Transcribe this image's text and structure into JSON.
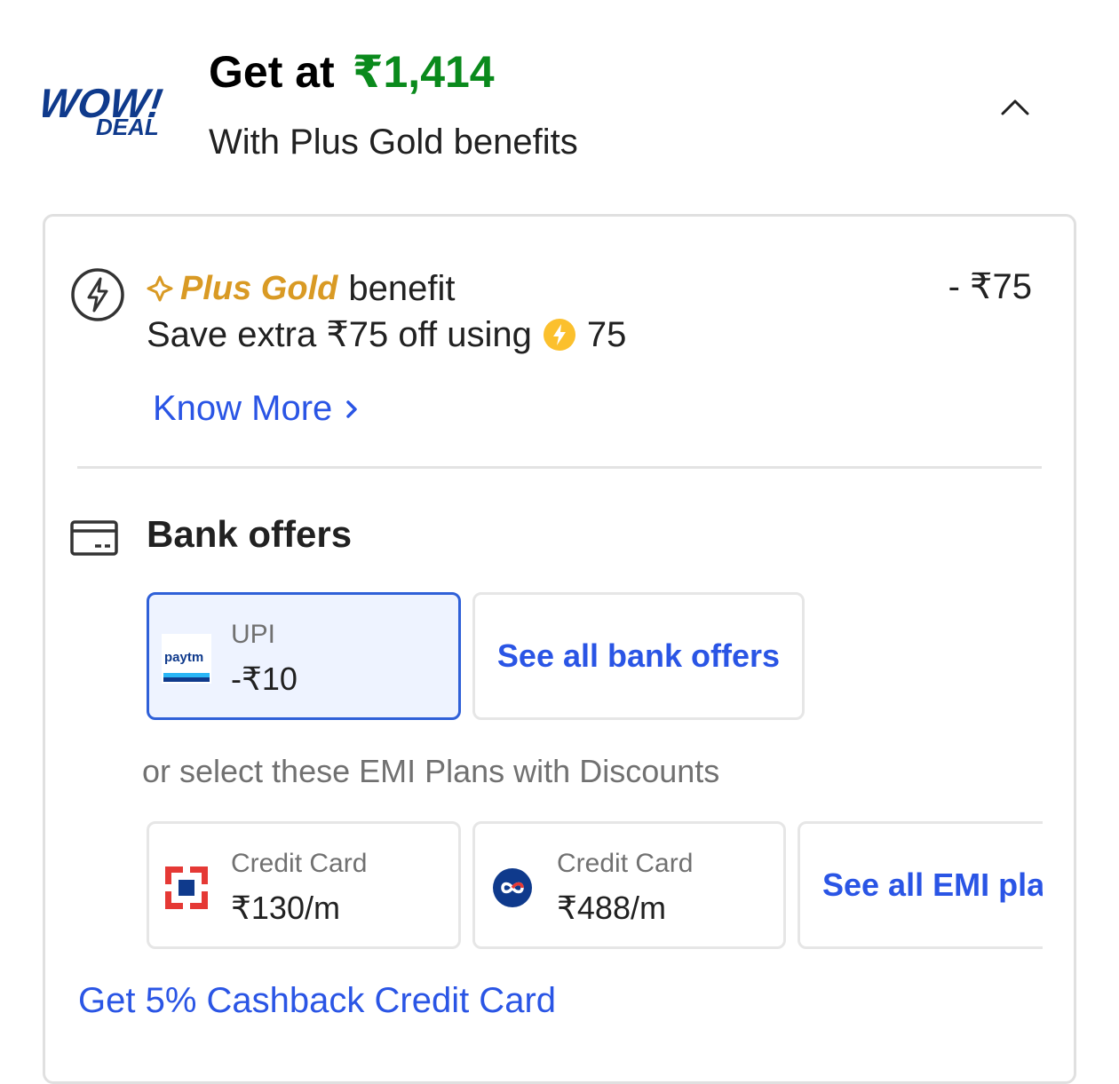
{
  "header": {
    "logo_word_1": "WOW!",
    "logo_word_2": "DEAL",
    "headline_prefix": "Get at",
    "headline_price": "₹1,414",
    "subline": "With Plus Gold benefits"
  },
  "plus_gold": {
    "brand": "Plus Gold",
    "benefit_label": "benefit",
    "save_text": "Save extra ₹75 off using",
    "coin_count": "75",
    "discount": "- ₹75",
    "know_more": "Know More"
  },
  "bank_offers": {
    "title": "Bank offers",
    "upi_tile": {
      "logo": "paytm",
      "label": "UPI",
      "amount": "-₹10"
    },
    "see_all_label": "See all bank offers"
  },
  "emi": {
    "hint": "or select these EMI Plans with Discounts",
    "plans": [
      {
        "label": "Credit Card",
        "amount": "₹130/m"
      },
      {
        "label": "Credit Card",
        "amount": "₹488/m"
      }
    ],
    "see_all_label": "See all EMI plans"
  },
  "cashback_link": "Get 5% Cashback Credit Card",
  "colors": {
    "price_green": "#0a8a1c",
    "link_blue": "#2a55e5",
    "plus_gold": "#d99a24",
    "selected_border": "#2f60d8",
    "selected_bg": "#eef3ff"
  }
}
